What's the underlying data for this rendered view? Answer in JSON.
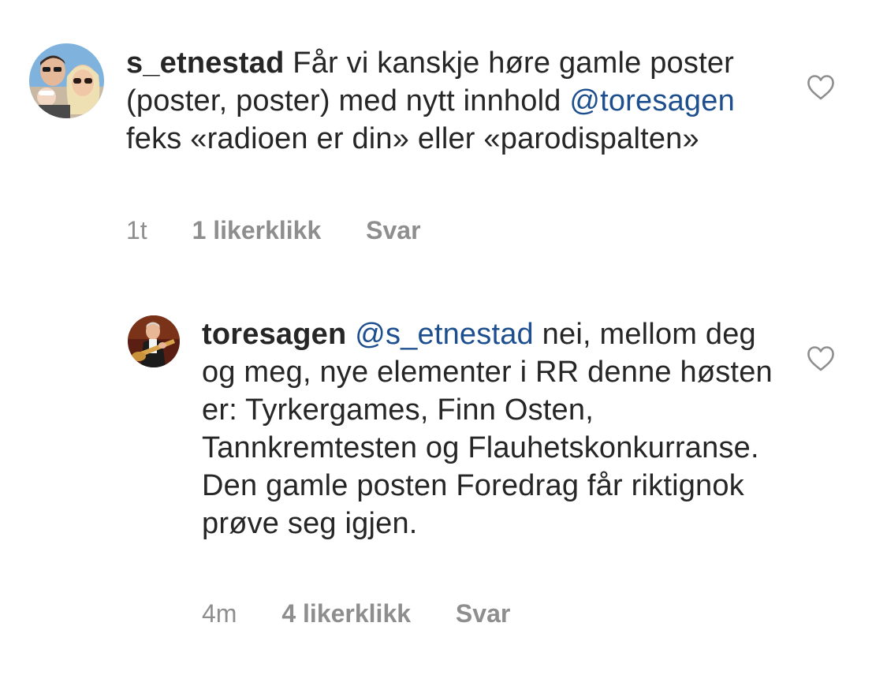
{
  "comments": [
    {
      "username": "s_etnestad",
      "text_before_mention": " Får vi kanskje høre gamle poster (poster, poster) med nytt innhold ",
      "mention": "@toresagen",
      "text_after_mention": " feks «radioen er din» eller «parodispalten»",
      "time": "1t",
      "likes": "1 likerklikk",
      "reply_label": "Svar",
      "like_icon": "heart-outline-icon"
    },
    {
      "username": "toresagen",
      "mention": "@s_etnestad",
      "text_after_mention": " nei, mellom deg og meg, nye elementer i RR denne høsten er: Tyrkergames, Finn Osten, Tannkremtesten og Flauhetskonkurranse. Den gamle posten Foredrag får riktignok prøve seg igjen.",
      "time": "4m",
      "likes": "4 likerklikk",
      "reply_label": "Svar",
      "like_icon": "heart-outline-icon"
    }
  ],
  "colors": {
    "text": "#262626",
    "mention": "#1d4f8f",
    "meta": "#8e8e8e",
    "heart_stroke": "#8e8e8e"
  }
}
